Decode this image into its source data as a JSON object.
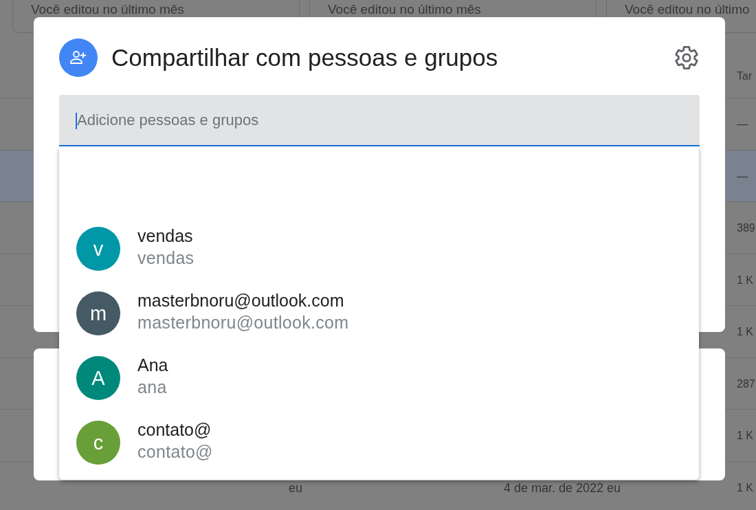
{
  "background": {
    "suggested_files": [
      {
        "activity": "Você editou no último mês"
      },
      {
        "activity": "Você editou no último mês"
      },
      {
        "activity": "Você editou no último"
      }
    ],
    "file_table": {
      "size_column_header": "Tar",
      "rows": [
        {
          "selected": false,
          "size": "—"
        },
        {
          "selected": true,
          "size": "—"
        },
        {
          "selected": false,
          "size": "389"
        },
        {
          "selected": false,
          "size": "1 K"
        },
        {
          "selected": false,
          "size": "1 K"
        },
        {
          "selected": false,
          "size": "287"
        },
        {
          "selected": false,
          "size": "1 K"
        },
        {
          "selected": false,
          "column_2": "eu",
          "column_3": "4 de mar. de 2022 eu",
          "size": "1 K"
        }
      ]
    }
  },
  "share_dialog": {
    "title": "Compartilhar com pessoas e grupos",
    "search": {
      "placeholder": "Adicione pessoas e grupos"
    },
    "suggestions": [
      {
        "initial": "v",
        "name": "vendas",
        "email": "vendas",
        "color": "#0097a7"
      },
      {
        "initial": "m",
        "name": "masterbnoru@outlook.com",
        "email": "masterbnoru@outlook.com",
        "color": "#455a64"
      },
      {
        "initial": "A",
        "name": "Ana",
        "email": "ana",
        "color": "#00897b"
      },
      {
        "initial": "c",
        "name": "contato@",
        "email": "contato@",
        "color": "#689f38"
      }
    ]
  }
}
